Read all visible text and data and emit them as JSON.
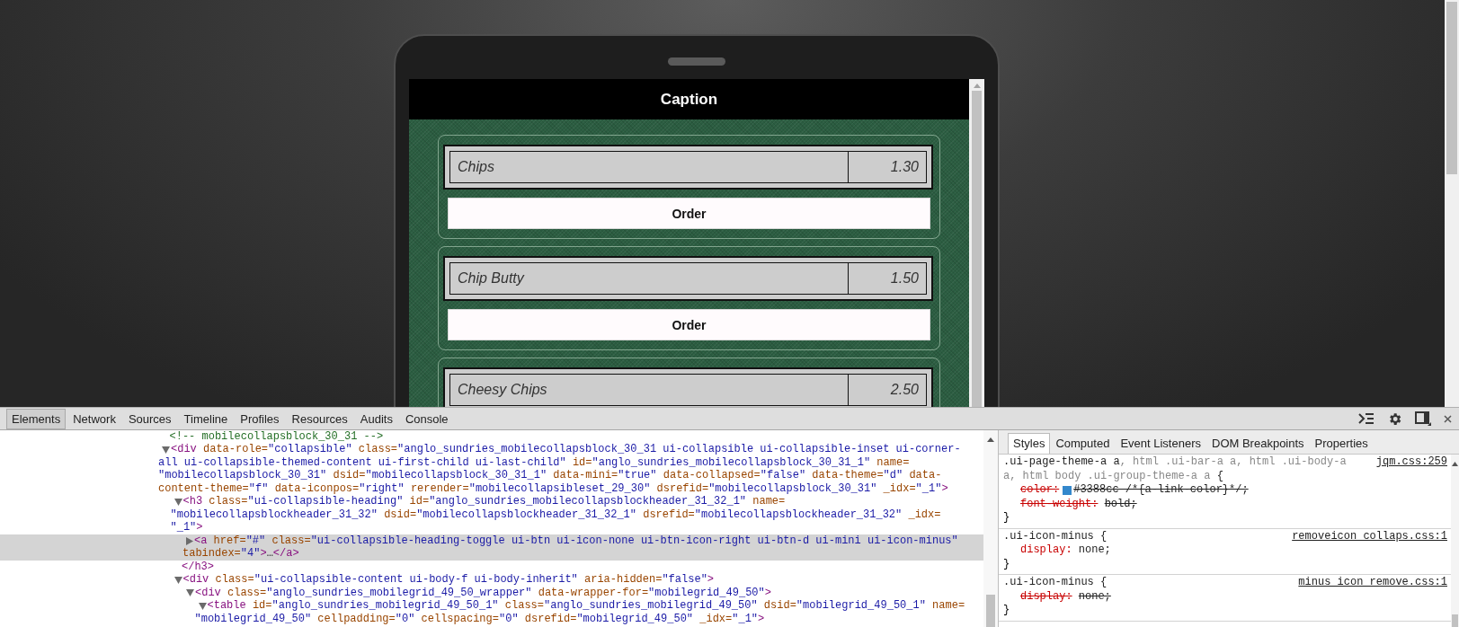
{
  "phone": {
    "header": {
      "title": "Caption"
    },
    "items": [
      {
        "name": "Chips",
        "price": "1.30",
        "button": "Order"
      },
      {
        "name": "Chip Butty",
        "price": "1.50",
        "button": "Order"
      },
      {
        "name": "Cheesy Chips",
        "price": "2.50"
      }
    ]
  },
  "devtools": {
    "tabs": [
      {
        "label": "Elements",
        "selected": true
      },
      {
        "label": "Network",
        "selected": false
      },
      {
        "label": "Sources",
        "selected": false
      },
      {
        "label": "Timeline",
        "selected": false
      },
      {
        "label": "Profiles",
        "selected": false
      },
      {
        "label": "Resources",
        "selected": false
      },
      {
        "label": "Audits",
        "selected": false
      },
      {
        "label": "Console",
        "selected": false
      }
    ],
    "elements": {
      "nodes": [
        {
          "kind": "comment",
          "selected": false,
          "lines": [
            "<!-- mobilecollapsblock_30_31 -->"
          ]
        },
        {
          "kind": "element",
          "selected": false,
          "expanded": true,
          "lines": [
            "<div data-role=\"collapsible\" class=\"anglo_sundries_mobilecollapsblock_30_31 ui-collapsible ui-collapsible-inset ui-corner-",
            "all ui-collapsible-themed-content ui-first-child ui-last-child\" id=\"anglo_sundries_mobilecollapsblock_30_31_1\" name=",
            "\"mobilecollapsblock_30_31\" dsid=\"mobilecollapsblock_30_31_1\" data-mini=\"true\" data-collapsed=\"false\" data-theme=\"d\" data-",
            "content-theme=\"f\" data-iconpos=\"right\" rerender=\"mobilecollapsibleset_29_30\" dsrefid=\"mobilecollapsblock_30_31\" _idx=\"_1\">"
          ],
          "children": [
            {
              "kind": "element",
              "selected": false,
              "expanded": true,
              "lines": [
                "<h3 class=\"ui-collapsible-heading\" id=\"anglo_sundries_mobilecollapsblockheader_31_32_1\" name=",
                "\"mobilecollapsblockheader_31_32\" dsid=\"mobilecollapsblockheader_31_32_1\" dsrefid=\"mobilecollapsblockheader_31_32\" _idx=",
                "\"_1\">"
              ],
              "children": [
                {
                  "kind": "element",
                  "selected": true,
                  "expanded": false,
                  "lines": [
                    "<a href=\"#\" class=\"ui-collapsible-heading-toggle ui-btn ui-icon-none ui-btn-icon-right ui-btn-d ui-mini ui-icon-minus\"",
                    "tabindex=\"4\">…</a>"
                  ]
                }
              ],
              "close": "</h3>"
            },
            {
              "kind": "element",
              "selected": false,
              "expanded": true,
              "lines": [
                "<div class=\"ui-collapsible-content ui-body-f ui-body-inherit\" aria-hidden=\"false\">"
              ],
              "children": [
                {
                  "kind": "element",
                  "selected": false,
                  "expanded": true,
                  "lines": [
                    "<div class=\"anglo_sundries_mobilegrid_49_50_wrapper\" data-wrapper-for=\"mobilegrid_49_50\">"
                  ],
                  "children": [
                    {
                      "kind": "element",
                      "selected": false,
                      "expanded": true,
                      "lines": [
                        "<table id=\"anglo_sundries_mobilegrid_49_50_1\" class=\"anglo_sundries_mobilegrid_49_50\" dsid=\"mobilegrid_49_50_1\" name=",
                        "\"mobilegrid_49_50\" cellpadding=\"0\" cellspacing=\"0\" dsrefid=\"mobilegrid_49_50\" _idx=\"_1\">"
                      ]
                    }
                  ]
                }
              ]
            }
          ]
        }
      ]
    },
    "styles": {
      "tabs": [
        {
          "label": "Styles",
          "selected": true
        },
        {
          "label": "Computed",
          "selected": false
        },
        {
          "label": "Event Listeners",
          "selected": false
        },
        {
          "label": "DOM Breakpoints",
          "selected": false
        },
        {
          "label": "Properties",
          "selected": false
        }
      ],
      "rules": [
        {
          "matched_selector": ".ui-page-theme-a a",
          "other_selectors": ", html .ui-bar-a a, html .ui-body-a a, html body .ui-group-theme-a a",
          "brace_open": "{",
          "brace_close": "}",
          "source": "jqm.css:259",
          "properties": [
            {
              "name": "color:",
              "value": "#3388cc /*{a-link-color}*/;",
              "overridden": true,
              "color": "#3388cc"
            },
            {
              "name": "font-weight:",
              "value": "bold;",
              "overridden": true
            }
          ]
        },
        {
          "matched_selector": ".ui-icon-minus",
          "brace_open": "{",
          "brace_close": "}",
          "source": "removeicon_collaps.css:1",
          "properties": [
            {
              "name": "display:",
              "value": "none;",
              "overridden": false
            }
          ]
        },
        {
          "matched_selector": ".ui-icon-minus",
          "brace_open": "{",
          "brace_close": "}",
          "source": "minus_icon_remove.css:1",
          "properties": [
            {
              "name": "display:",
              "value": "none;",
              "overridden": true
            }
          ]
        }
      ]
    }
  }
}
